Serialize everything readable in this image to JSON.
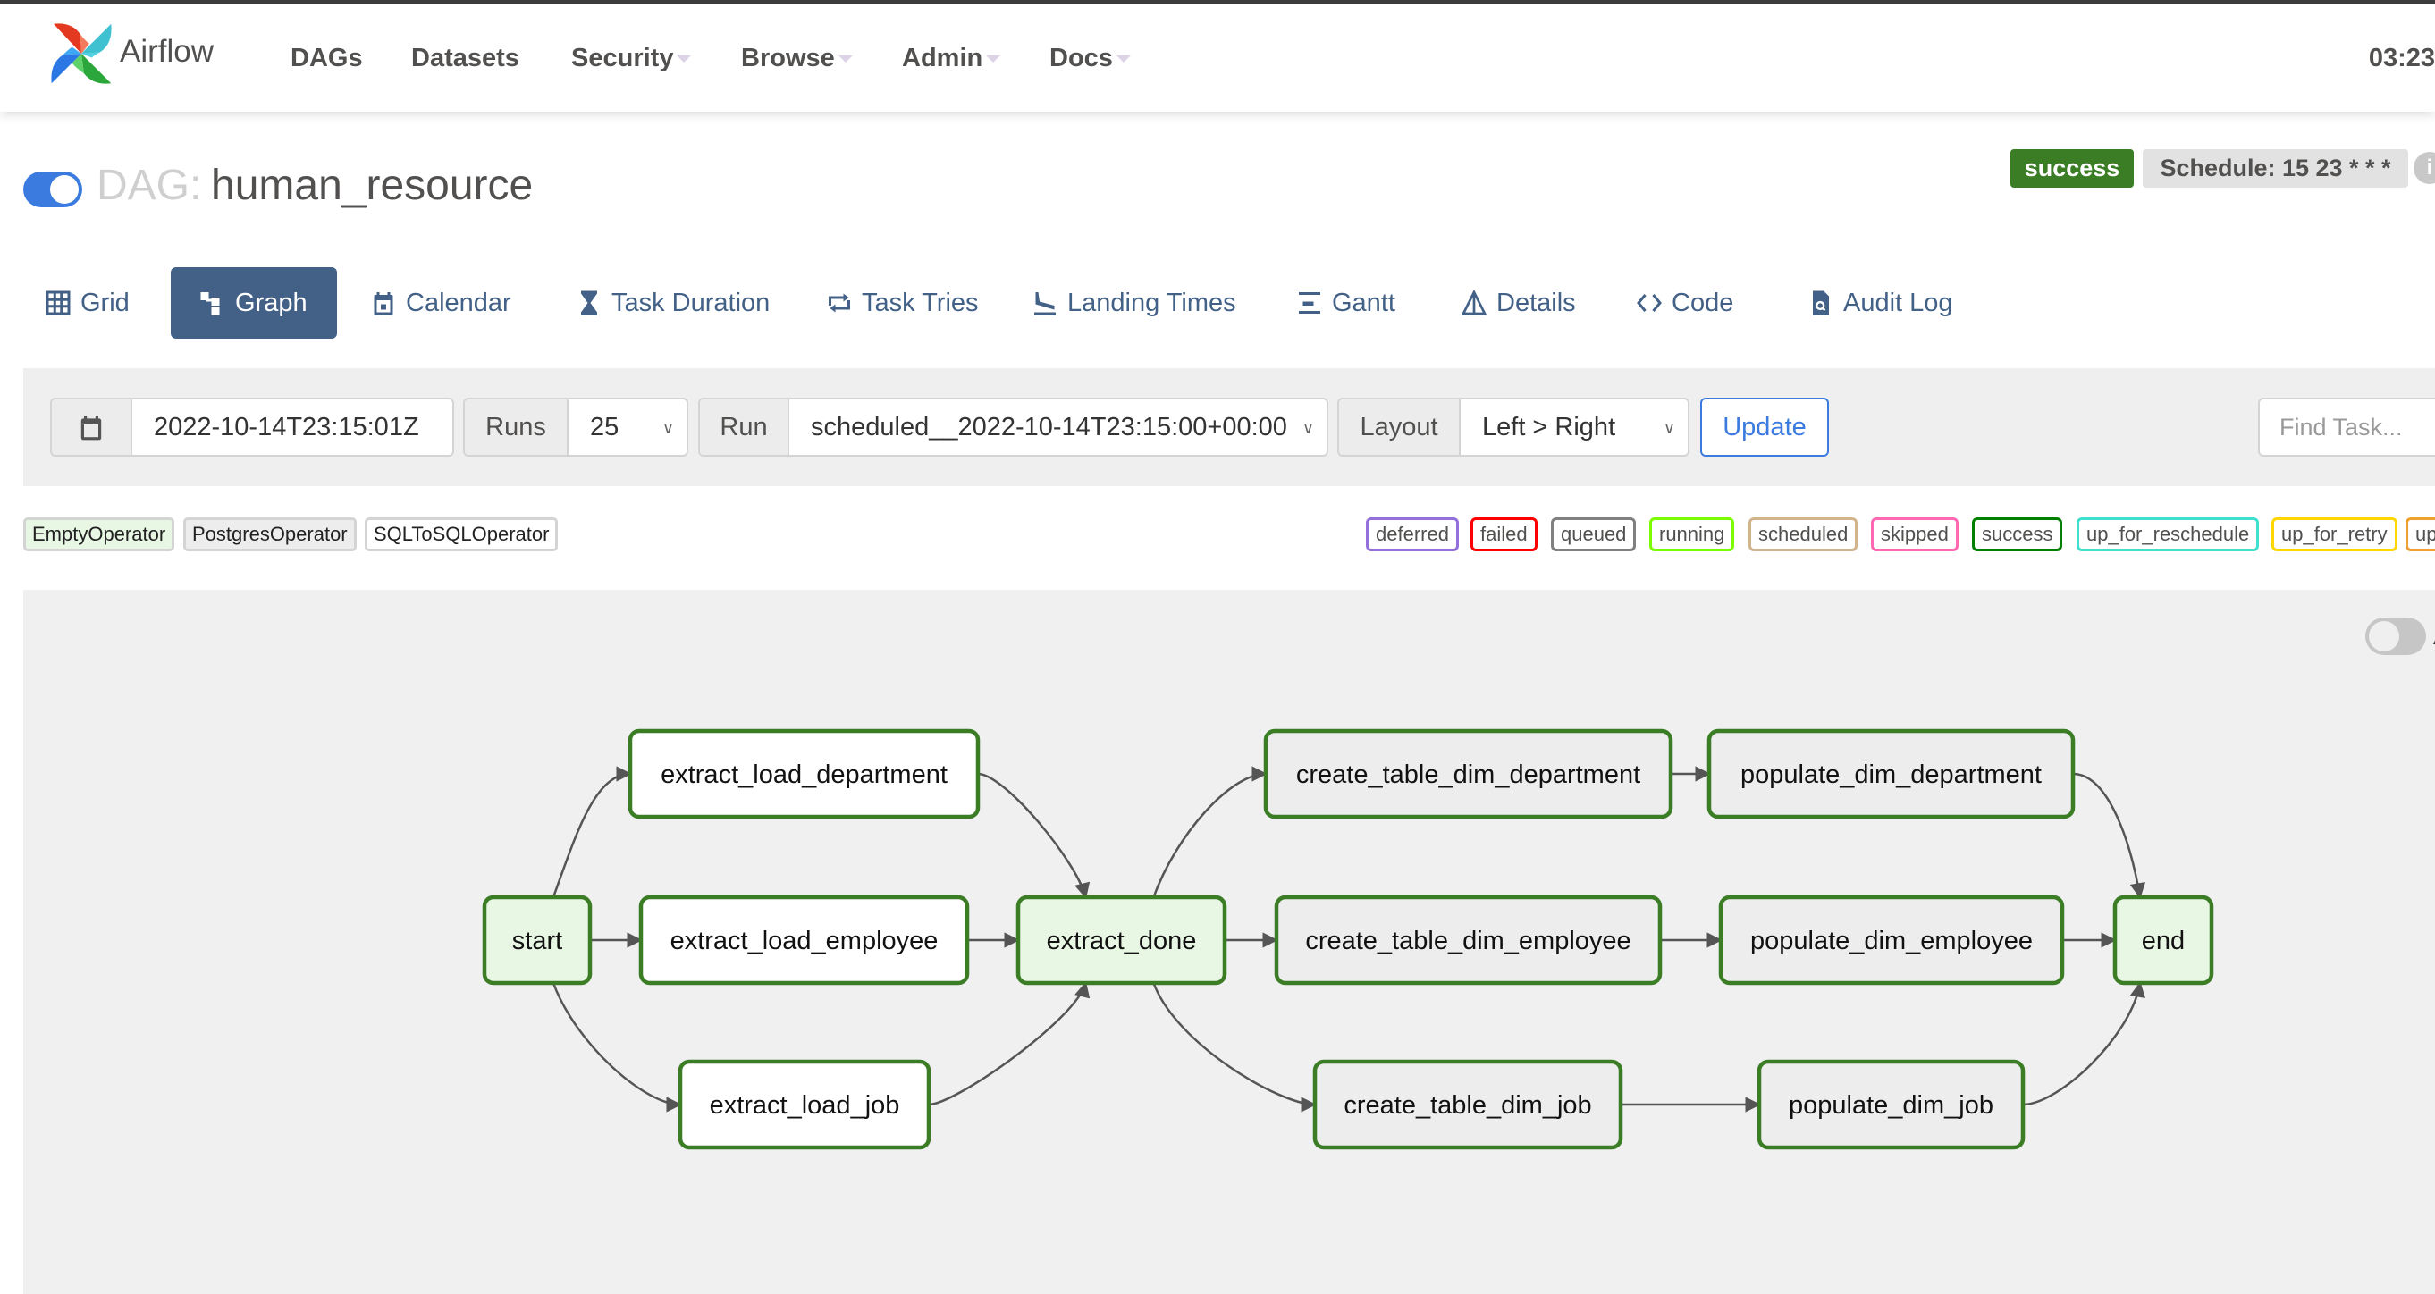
{
  "navbar": {
    "brand": "Airflow",
    "items": [
      {
        "label": "DAGs",
        "dropdown": false
      },
      {
        "label": "Datasets",
        "dropdown": false
      },
      {
        "label": "Security",
        "dropdown": true
      },
      {
        "label": "Browse",
        "dropdown": true
      },
      {
        "label": "Admin",
        "dropdown": true
      },
      {
        "label": "Docs",
        "dropdown": true
      }
    ],
    "clock": "03:23"
  },
  "dag": {
    "prefix": "DAG:",
    "name": "human_resource",
    "paused": false,
    "status": "success",
    "schedule": "Schedule: 15 23 * * *",
    "info_icon": "i"
  },
  "tabs": [
    {
      "label": "Grid",
      "icon": "grid-icon",
      "active": false
    },
    {
      "label": "Graph",
      "icon": "graph-icon",
      "active": true
    },
    {
      "label": "Calendar",
      "icon": "calendar-icon",
      "active": false
    },
    {
      "label": "Task Duration",
      "icon": "hourglass-icon",
      "active": false
    },
    {
      "label": "Task Tries",
      "icon": "retweet-icon",
      "active": false
    },
    {
      "label": "Landing Times",
      "icon": "plane-landing-icon",
      "active": false
    },
    {
      "label": "Gantt",
      "icon": "gantt-icon",
      "active": false
    },
    {
      "label": "Details",
      "icon": "triangle-icon",
      "active": false
    },
    {
      "label": "Code",
      "icon": "code-icon",
      "active": false
    },
    {
      "label": "Audit Log",
      "icon": "file-search-icon",
      "active": false
    }
  ],
  "controls": {
    "base_date": "2022-10-14T23:15:01Z",
    "runs_label": "Runs",
    "runs_value": "25",
    "run_label": "Run",
    "run_value": "scheduled__2022-10-14T23:15:00+00:00",
    "layout_label": "Layout",
    "layout_value": "Left > Right",
    "update_label": "Update",
    "find_task_placeholder": "Find Task..."
  },
  "operators": [
    {
      "label": "EmptyOperator",
      "color": "#e8f7e4"
    },
    {
      "label": "PostgresOperator",
      "color": "#ededed"
    },
    {
      "label": "SQLToSQLOperator",
      "color": "#ffffff"
    }
  ],
  "states": [
    {
      "label": "deferred",
      "color": "#9470dc"
    },
    {
      "label": "failed",
      "color": "#ff0000"
    },
    {
      "label": "queued",
      "color": "#808080"
    },
    {
      "label": "running",
      "color": "#7cfc00"
    },
    {
      "label": "scheduled",
      "color": "#d2b48c"
    },
    {
      "label": "skipped",
      "color": "#ff69b4"
    },
    {
      "label": "success",
      "color": "#008000"
    },
    {
      "label": "up_for_reschedule",
      "color": "#40e0d0"
    },
    {
      "label": "up_for_retry",
      "color": "#ffd700"
    },
    {
      "label": "up",
      "color": "#f0a030"
    }
  ],
  "graph": {
    "auto_refresh_label": "A",
    "auto_refresh_on": false,
    "nodes": [
      {
        "id": "start",
        "label": "start",
        "operator": "EmptyOperator",
        "state": "success"
      },
      {
        "id": "extract_load_department",
        "label": "extract_load_department",
        "operator": "SQLToSQLOperator",
        "state": "success"
      },
      {
        "id": "extract_load_employee",
        "label": "extract_load_employee",
        "operator": "SQLToSQLOperator",
        "state": "success"
      },
      {
        "id": "extract_load_job",
        "label": "extract_load_job",
        "operator": "SQLToSQLOperator",
        "state": "success"
      },
      {
        "id": "extract_done",
        "label": "extract_done",
        "operator": "EmptyOperator",
        "state": "success"
      },
      {
        "id": "create_table_dim_department",
        "label": "create_table_dim_department",
        "operator": "PostgresOperator",
        "state": "success"
      },
      {
        "id": "create_table_dim_employee",
        "label": "create_table_dim_employee",
        "operator": "PostgresOperator",
        "state": "success"
      },
      {
        "id": "create_table_dim_job",
        "label": "create_table_dim_job",
        "operator": "PostgresOperator",
        "state": "success"
      },
      {
        "id": "populate_dim_department",
        "label": "populate_dim_department",
        "operator": "PostgresOperator",
        "state": "success"
      },
      {
        "id": "populate_dim_employee",
        "label": "populate_dim_employee",
        "operator": "PostgresOperator",
        "state": "success"
      },
      {
        "id": "populate_dim_job",
        "label": "populate_dim_job",
        "operator": "PostgresOperator",
        "state": "success"
      },
      {
        "id": "end",
        "label": "end",
        "operator": "EmptyOperator",
        "state": "success"
      }
    ],
    "edges": [
      [
        "start",
        "extract_load_department"
      ],
      [
        "start",
        "extract_load_employee"
      ],
      [
        "start",
        "extract_load_job"
      ],
      [
        "extract_load_department",
        "extract_done"
      ],
      [
        "extract_load_employee",
        "extract_done"
      ],
      [
        "extract_load_job",
        "extract_done"
      ],
      [
        "extract_done",
        "create_table_dim_department"
      ],
      [
        "extract_done",
        "create_table_dim_employee"
      ],
      [
        "extract_done",
        "create_table_dim_job"
      ],
      [
        "create_table_dim_department",
        "populate_dim_department"
      ],
      [
        "create_table_dim_employee",
        "populate_dim_employee"
      ],
      [
        "create_table_dim_job",
        "populate_dim_job"
      ],
      [
        "populate_dim_department",
        "end"
      ],
      [
        "populate_dim_employee",
        "end"
      ],
      [
        "populate_dim_job",
        "end"
      ]
    ]
  }
}
